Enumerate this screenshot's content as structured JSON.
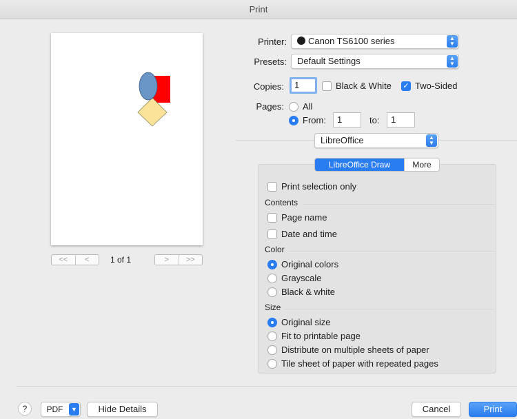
{
  "window": {
    "title": "Print"
  },
  "preview": {
    "page_indicator": "1 of 1",
    "first_glyph": "<<",
    "prev_glyph": "<",
    "next_glyph": ">",
    "last_glyph": ">>"
  },
  "printer": {
    "label": "Printer:",
    "value": "Canon TS6100 series"
  },
  "presets": {
    "label": "Presets:",
    "value": "Default Settings"
  },
  "copies": {
    "label": "Copies:",
    "value": "1",
    "bw_label": "Black & White",
    "bw_checked": false,
    "two_sided_label": "Two-Sided",
    "two_sided_checked": true
  },
  "pages": {
    "label": "Pages:",
    "all_label": "All",
    "from_label": "From:",
    "from_value": "1",
    "to_label": "to:",
    "to_value": "1",
    "selected": "from"
  },
  "app_menu": {
    "value": "LibreOffice"
  },
  "tabs": [
    {
      "label": "LibreOffice Draw",
      "active": true
    },
    {
      "label": "More",
      "active": false
    }
  ],
  "options": {
    "print_selection_only": "Print selection only",
    "contents": {
      "header": "Contents",
      "page_name": "Page name",
      "date_time": "Date and time"
    },
    "color": {
      "header": "Color",
      "options": [
        "Original colors",
        "Grayscale",
        "Black & white"
      ],
      "selected": 0
    },
    "size": {
      "header": "Size",
      "options": [
        "Original size",
        "Fit to printable page",
        "Distribute on multiple sheets of paper",
        "Tile sheet of paper with repeated pages"
      ],
      "selected": 0
    }
  },
  "footer": {
    "help": "?",
    "pdf": "PDF",
    "hide_details": "Hide Details",
    "cancel": "Cancel",
    "print": "Print"
  },
  "colors": {
    "accent": "#2a7df0",
    "shape_red": "#ff0000",
    "shape_blue": "#6a96c7",
    "shape_yellow": "#fbe49a"
  }
}
